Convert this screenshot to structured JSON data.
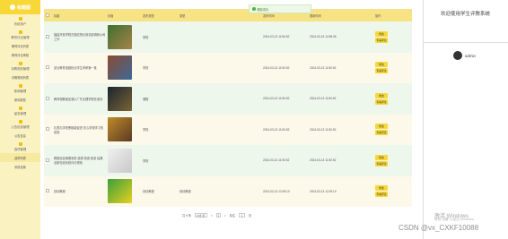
{
  "sidebar": {
    "brand": "标题图",
    "items": [
      {
        "type": "group",
        "label": "系统用户"
      },
      {
        "type": "group",
        "label": "教育评论管理"
      },
      {
        "type": "sub",
        "label": "教育评论列表"
      },
      {
        "type": "sub",
        "label": "教育评论审核"
      },
      {
        "type": "group",
        "label": "评教规则管理"
      },
      {
        "type": "sub",
        "label": "评教规则列表"
      },
      {
        "type": "group",
        "label": "新闻管理"
      },
      {
        "type": "sub",
        "label": "新闻类型"
      },
      {
        "type": "group",
        "label": "留言管理"
      },
      {
        "type": "group",
        "label": "公告信息管理"
      },
      {
        "type": "sub",
        "label": "公告信息"
      },
      {
        "type": "group",
        "label": "选项管理"
      },
      {
        "type": "sub",
        "label": "选项列表",
        "active": true
      },
      {
        "type": "sub",
        "label": "系统设置"
      }
    ]
  },
  "toast": "删除成功",
  "table": {
    "headers": [
      "",
      "标题",
      "封面",
      "发布类型",
      "类型",
      "发布时间",
      "更新时间",
      "操作"
    ],
    "rows": [
      {
        "title": "福建开放学院古丽红院长到总部调研公司工作",
        "type": "学校",
        "time1": "2024-03-13 11:50:52",
        "time2": "2024-03-15 12:55:36",
        "c1": "#3e7030",
        "c2": "#a8824a"
      },
      {
        "title": "该业教育选题秒点学生考研第一批",
        "type": "学校",
        "time1": "2024-03-13 11:50:52",
        "time2": "2024-03-13 11:50:52",
        "c1": "#8a4a34",
        "c2": "#3c6a96"
      },
      {
        "title": "教育观察者加强以广东业理学院在培训",
        "type": "课程",
        "time1": "2024-03-13 11:50:52",
        "time2": "2024-03-13 11:50:52",
        "c1": "#1c2430",
        "c2": "#7a6434"
      },
      {
        "title": "扎根扎学校黑枢能促进 关心学校学习的成就",
        "type": "学校",
        "time1": "2024-03-13 11:50:52",
        "time2": "2024-03-13 11:50:52",
        "c1": "#c08a2a",
        "c2": "#5a3a24"
      },
      {
        "title": "教程信息管理系统 选修 检索 检查 结果 全新在线系统评分规则",
        "type": "学校",
        "time1": "2024-03-13 11:50:52",
        "time2": "2024-03-13 11:50:52",
        "c1": "#f0f0f0",
        "c2": "#c8c8c8"
      },
      {
        "title": "钱动教程",
        "type": "钱动教程",
        "category": "钱动教程",
        "time1": "2024-03-13 12:09:10",
        "time2": "2024-03-13 12:09:10",
        "c1": "#3aa03a",
        "c2": "#e8d020"
      }
    ],
    "actions": [
      "修改",
      "查看评论"
    ]
  },
  "pagination": {
    "total": "共 6 条",
    "page_size": "10条/页",
    "prev": "<",
    "page": "1",
    "next": ">",
    "goto_prefix": "前往",
    "goto_value": "1",
    "goto_suffix": "页"
  },
  "right": {
    "welcome": "欢迎使用学生评教系统",
    "username": "admin"
  },
  "watermark": {
    "line1": "激活 Windows",
    "line2": "转到\"设置\"以激活 Windows。",
    "line3": "CSDN @vx_CXKF10088"
  },
  "colors": {
    "accent": "#f8d838",
    "sidebar": "#fbf2c2",
    "header": "#f8e384"
  }
}
